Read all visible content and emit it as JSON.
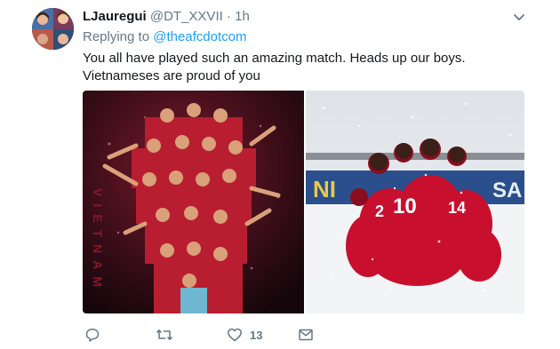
{
  "tweet": {
    "display_name": "LJauregui",
    "handle": "@DT_XXVII",
    "separator": "·",
    "time": "1h",
    "replying_prefix": "Replying to",
    "replying_to": "@theafcdotcom",
    "text": "You all have played such an amazing match. Heads up our boys. Vietnameses are proud of you",
    "media": {
      "left_poster_text": "VIETNAM",
      "right_board_text": "NI",
      "right_board_text_2": "SA",
      "jersey_numbers": [
        "2",
        "10",
        "14"
      ]
    }
  },
  "actions": {
    "reply_icon": "reply-icon",
    "retweet_icon": "retweet-icon",
    "like_icon": "heart-icon",
    "like_count": "13",
    "dm_icon": "envelope-icon"
  },
  "colors": {
    "link": "#1da1f2",
    "muted": "#657786",
    "text": "#14171a",
    "jersey_red": "#c8102e"
  }
}
